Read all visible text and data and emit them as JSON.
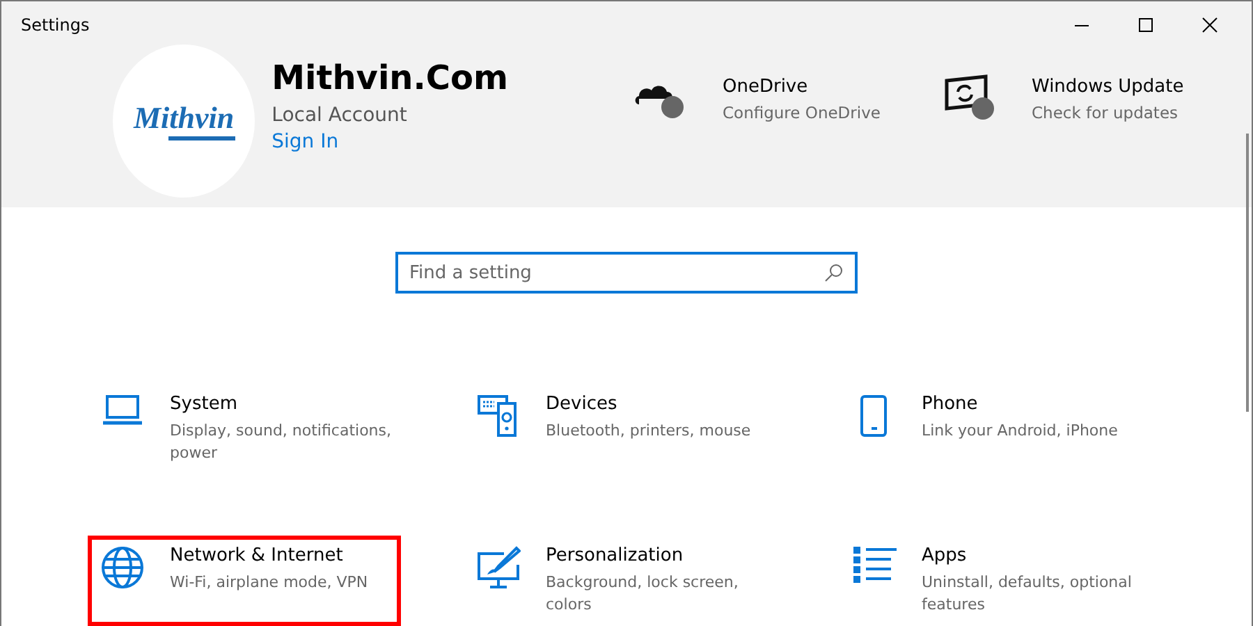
{
  "window": {
    "title": "Settings"
  },
  "account": {
    "logo_text": "Mithvin",
    "name": "Mithvin.Com",
    "type": "Local Account",
    "sign_in": "Sign In"
  },
  "quick_links": [
    {
      "kind": "cloud",
      "title": "OneDrive",
      "subtitle": "Configure OneDrive"
    },
    {
      "kind": "update",
      "title": "Windows Update",
      "subtitle": "Check for updates"
    }
  ],
  "search": {
    "placeholder": "Find a setting"
  },
  "categories": [
    {
      "kind": "laptop",
      "title": "System",
      "subtitle": "Display, sound, notifications, power",
      "highlighted": false
    },
    {
      "kind": "devices",
      "title": "Devices",
      "subtitle": "Bluetooth, printers, mouse",
      "highlighted": false
    },
    {
      "kind": "phone",
      "title": "Phone",
      "subtitle": "Link your Android, iPhone",
      "highlighted": false
    },
    {
      "kind": "globe",
      "title": "Network & Internet",
      "subtitle": "Wi-Fi, airplane mode, VPN",
      "highlighted": true
    },
    {
      "kind": "paint",
      "title": "Personalization",
      "subtitle": "Background, lock screen, colors",
      "highlighted": false
    },
    {
      "kind": "apps",
      "title": "Apps",
      "subtitle": "Uninstall, defaults, optional features",
      "highlighted": false
    }
  ]
}
